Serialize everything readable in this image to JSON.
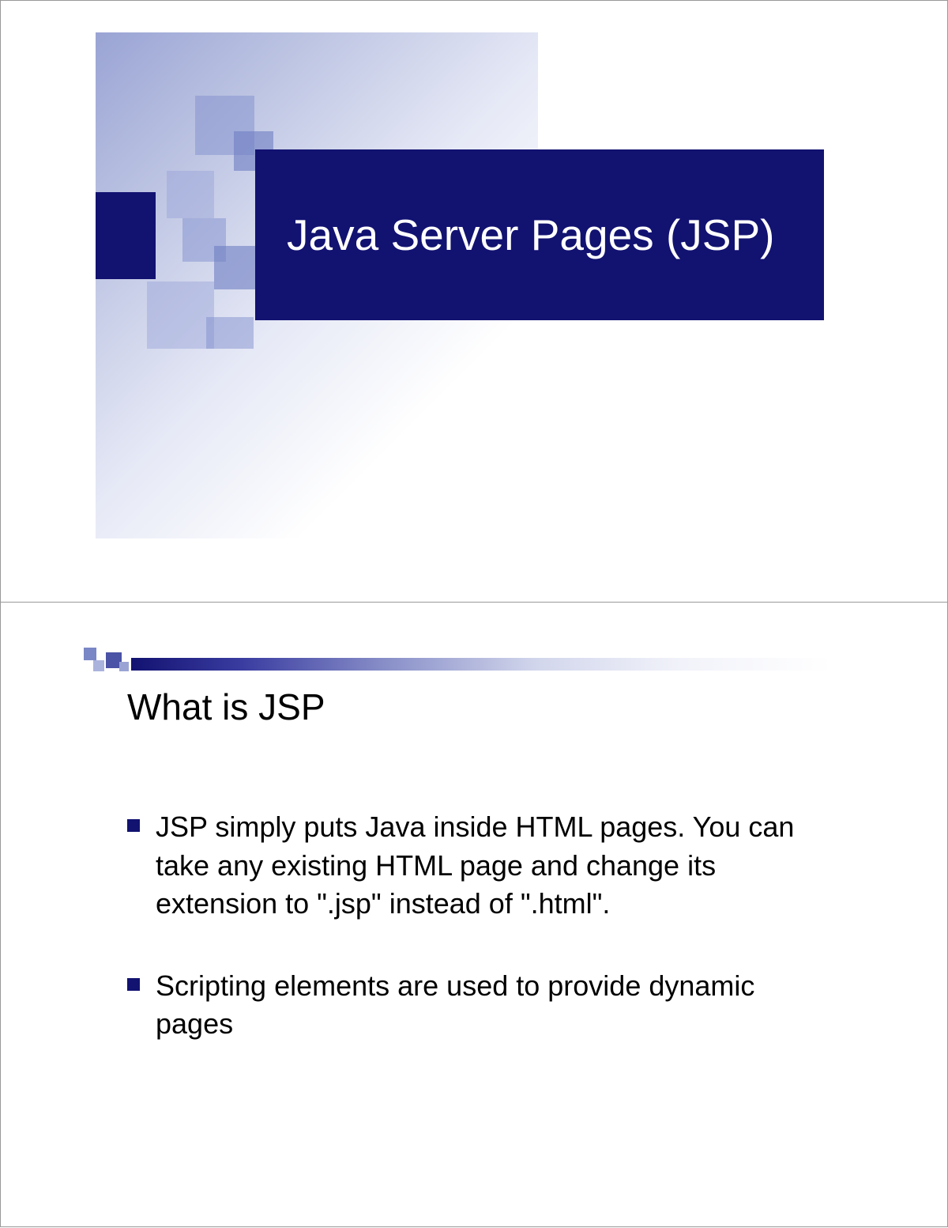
{
  "slide1": {
    "title": "Java Server Pages (JSP)"
  },
  "slide2": {
    "title": "What is JSP",
    "bullets": [
      "JSP simply puts Java inside HTML pages.  You can take any existing HTML page and change its extension to \".jsp\" instead of \".html\".",
      "Scripting elements are used to provide dynamic pages"
    ]
  }
}
